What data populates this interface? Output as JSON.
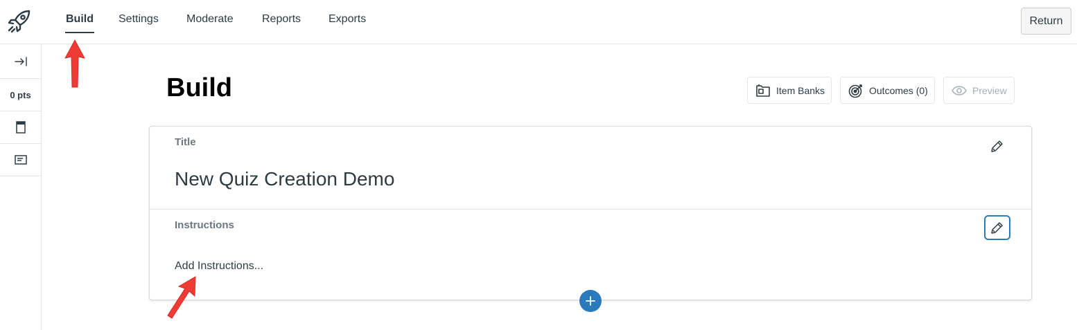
{
  "nav": {
    "logo_icon": "rocket-icon",
    "tabs": [
      {
        "label": "Build",
        "active": true
      },
      {
        "label": "Settings",
        "active": false
      },
      {
        "label": "Moderate",
        "active": false
      },
      {
        "label": "Reports",
        "active": false
      },
      {
        "label": "Exports",
        "active": false
      }
    ],
    "return_label": "Return"
  },
  "rail": {
    "collapse_icon": "arrow-to-right-icon",
    "points_label": "0 pts",
    "items": [
      "document-icon",
      "list-icon"
    ]
  },
  "main": {
    "page_title": "Build",
    "buttons": {
      "item_banks": "Item Banks",
      "outcomes": "Outcomes (0)",
      "preview": "Preview"
    },
    "title_label": "Title",
    "quiz_title": "New Quiz Creation Demo",
    "instructions_label": "Instructions",
    "instructions_placeholder": "Add Instructions..."
  },
  "colors": {
    "accent": "#2b7abc",
    "annotation_arrow": "#ee3b36",
    "text": "#2d3b45",
    "muted_label": "#6b7780"
  }
}
